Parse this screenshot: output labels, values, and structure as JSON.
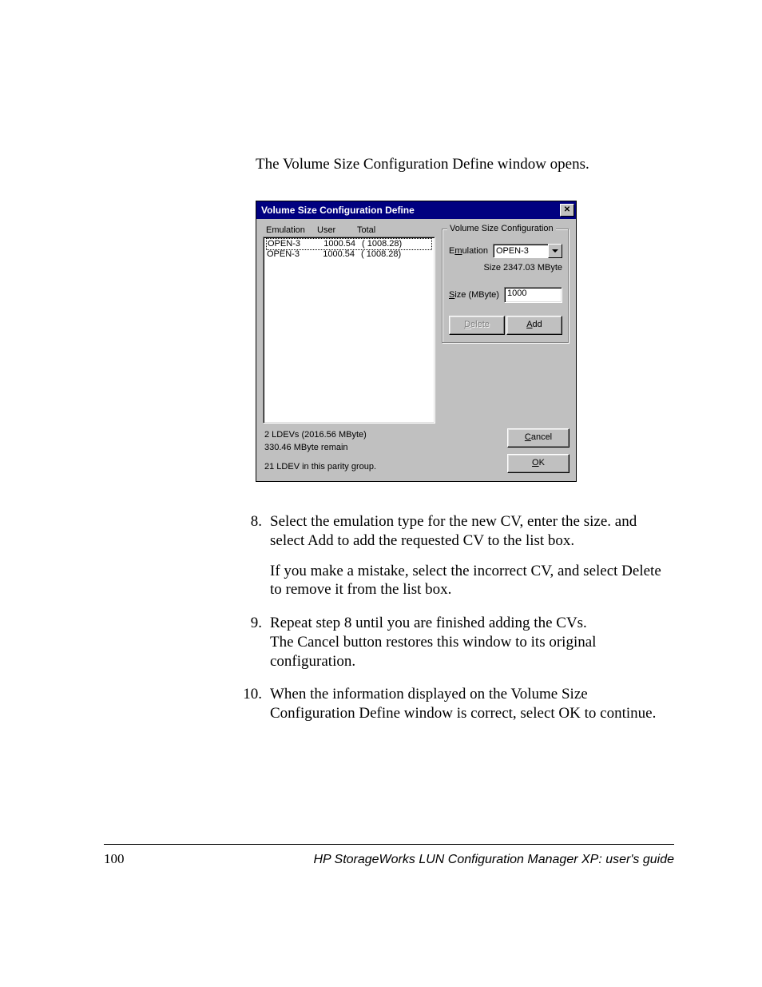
{
  "intro_text": "The Volume Size Configuration Define window opens.",
  "dialog": {
    "title": "Volume Size Configuration Define",
    "headers": {
      "c1": "Emulation",
      "c2": "User",
      "c3": "Total"
    },
    "rows": [
      {
        "emu": "OPEN-3",
        "user": "1000.54",
        "total": "(  1008.28)"
      },
      {
        "emu": "OPEN-3",
        "user": "1000.54",
        "total": "(  1008.28)"
      }
    ],
    "status": {
      "line1": "2 LDEVs (2016.56 MByte)",
      "line2": "330.46 MByte remain",
      "line3": "21 LDEV in this parity group."
    },
    "group_title": "Volume Size Configuration",
    "emulation_label_pre": "E",
    "emulation_label_u": "m",
    "emulation_label_post": "ulation",
    "emulation_value": "OPEN-3",
    "size_info": "Size  2347.03 MByte",
    "size_label_u": "S",
    "size_label_post": "ize (MByte)",
    "size_value": "1000",
    "delete_u": "D",
    "delete_rest": "elete",
    "add_u": "A",
    "add_rest": "dd",
    "cancel_u": "C",
    "cancel_rest": "ancel",
    "ok_u": "O",
    "ok_rest": "K"
  },
  "steps": {
    "s8_num": "8.",
    "s8_p1": "Select the emulation type for the new CV, enter the size. and select Add to add the requested CV to the list box.",
    "s8_p2": "If you make a mistake, select the incorrect CV, and select Delete to remove it from the list box.",
    "s9_num": "9.",
    "s9_p1": "Repeat step 8 until you are finished adding the CVs.",
    "s9_p2": "The Cancel button restores this window to its original configuration.",
    "s10_num": "10.",
    "s10_p1": "When the information displayed on the Volume Size Configuration Define window is correct, select OK to continue."
  },
  "footer": {
    "pageno": "100",
    "guide": "HP StorageWorks LUN Configuration Manager XP: user's guide"
  }
}
